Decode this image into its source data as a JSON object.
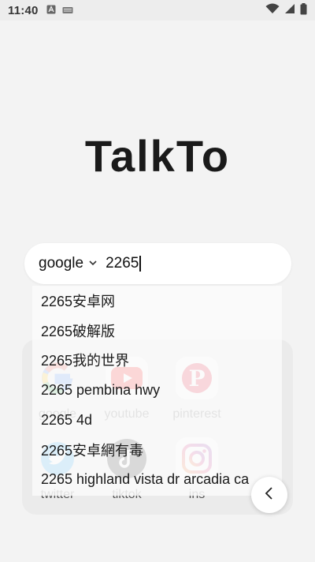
{
  "status_bar": {
    "time": "11:40",
    "icons": [
      "a-icon",
      "keyboard-icon",
      "wifi-icon",
      "signal-icon",
      "battery-icon"
    ]
  },
  "app": {
    "title": "TalkTo"
  },
  "search": {
    "engine": "google",
    "query": "2265"
  },
  "suggestions": [
    "2265安卓网",
    "2265破解版",
    "2265我的世界",
    "2265 pembina hwy",
    "2265 4d",
    "2265安卓網有毒",
    "2265 highland vista dr arcadia ca"
  ],
  "shortcuts": [
    {
      "label": "google",
      "icon": "google-icon"
    },
    {
      "label": "youtube",
      "icon": "youtube-icon"
    },
    {
      "label": "pinterest",
      "icon": "pinterest-icon"
    },
    {
      "label": "twitter",
      "icon": "twitter-icon"
    },
    {
      "label": "tiktok",
      "icon": "tiktok-icon"
    },
    {
      "label": "ins",
      "icon": "instagram-icon"
    }
  ],
  "colors": {
    "background": "#f3f3f3",
    "youtube": "#ff0000",
    "pinterest": "#e60023",
    "twitter": "#1da1f2",
    "tiktok": "#111111",
    "instagram": "#e1306c"
  }
}
